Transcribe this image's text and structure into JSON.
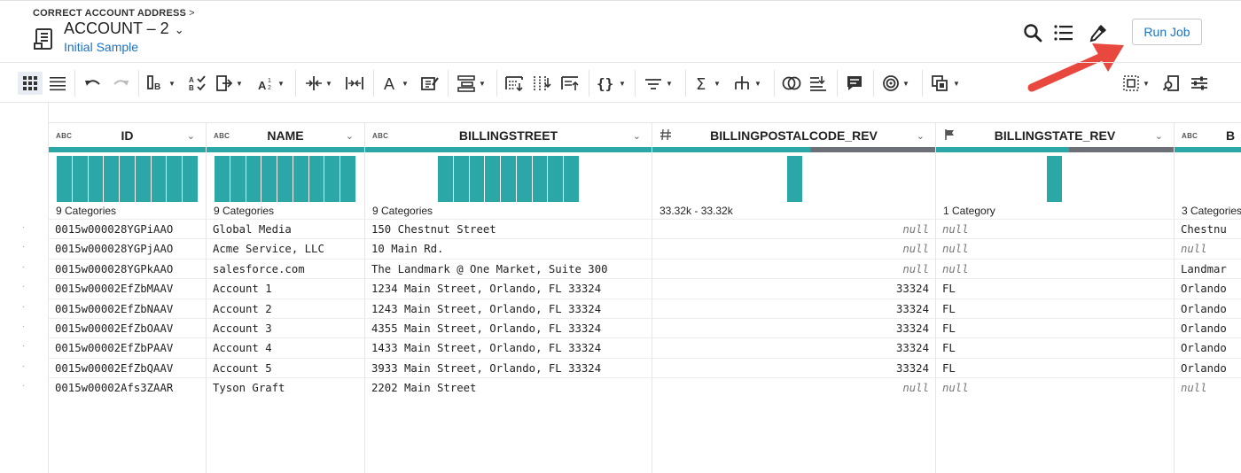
{
  "header": {
    "breadcrumb": "CORRECT ACCOUNT ADDRESS",
    "breadcrumb_chevron": ">",
    "title": "ACCOUNT – 2",
    "title_dropdown": "⌄",
    "subtitle": "Initial Sample",
    "run_job_label": "Run Job"
  },
  "colors": {
    "accent": "#1a73c8",
    "histogram": "#2aa7a6",
    "quality_valid": "#2aa7a6",
    "quality_missing": "#6e7078",
    "arrow": "#e8483d"
  },
  "toolbar_icons": [
    "grid-view-icon",
    "list-view-icon",
    "undo-icon",
    "redo-icon",
    "rename-columns-icon",
    "checklist-icon",
    "move-icon",
    "sort-icon",
    "split-icon",
    "merge-icon",
    "text-icon",
    "format-icon",
    "restructure-icon",
    "filter-rows-icon",
    "replace-icon",
    "extract-icon",
    "nested-icon",
    "filter-icon",
    "sum-icon",
    "hierarchy-icon",
    "join-icon",
    "union-icon",
    "comment-icon",
    "target-icon",
    "copy-icon",
    "selection-icon",
    "lookup-icon",
    "settings-icon"
  ],
  "columns": [
    {
      "type": "ABC",
      "name": "ID",
      "caret": "⌄",
      "category_label": "9 Categories"
    },
    {
      "type": "ABC",
      "name": "NAME",
      "caret": "⌄",
      "category_label": "9 Categories"
    },
    {
      "type": "ABC",
      "name": "BILLINGSTREET",
      "caret": "⌄",
      "category_label": "9 Categories"
    },
    {
      "type": "#",
      "name": "BILLINGPOSTALCODE_REV",
      "caret": "⌄",
      "category_label": "33.32k - 33.32k",
      "valid_fraction": 0.56
    },
    {
      "type": "flag",
      "name": "BILLINGSTATE_REV",
      "caret": "⌄",
      "category_label": "1 Category",
      "valid_fraction": 0.56
    },
    {
      "type": "ABC",
      "name": "B",
      "caret": "",
      "category_label": "3 Categories"
    }
  ],
  "rows": [
    [
      "0015w000028YGPiAAO",
      "Global Media",
      "150 Chestnut Street",
      "null",
      "null",
      "Chestnu"
    ],
    [
      "0015w000028YGPjAAO",
      "Acme Service, LLC",
      "10 Main Rd.",
      "null",
      "null",
      "null"
    ],
    [
      "0015w000028YGPkAAO",
      "salesforce.com",
      "The Landmark @ One Market, Suite 300",
      "null",
      "null",
      "Landmar"
    ],
    [
      "0015w00002EfZbMAAV",
      "Account 1",
      "1234 Main Street, Orlando, FL 33324",
      "33324",
      "FL",
      "Orlando"
    ],
    [
      "0015w00002EfZbNAAV",
      "Account 2",
      "1243 Main Street, Orlando, FL 33324",
      "33324",
      "FL",
      "Orlando"
    ],
    [
      "0015w00002EfZbOAAV",
      "Account 3",
      "4355 Main Street, Orlando, FL 33324",
      "33324",
      "FL",
      "Orlando"
    ],
    [
      "0015w00002EfZbPAAV",
      "Account 4",
      "1433 Main Street, Orlando, FL 33324",
      "33324",
      "FL",
      "Orlando"
    ],
    [
      "0015w00002EfZbQAAV",
      "Account 5",
      "3933 Main Street, Orlando, FL 33324",
      "33324",
      "FL",
      "Orlando"
    ],
    [
      "0015w00002Afs3ZAAR",
      "Tyson Graft",
      "2202 Main Street",
      "null",
      "null",
      "null"
    ]
  ],
  "histograms": [
    {
      "bars": 9
    },
    {
      "bars": 9
    },
    {
      "bars": 9
    },
    {
      "bars": 1
    },
    {
      "bars": 1
    },
    {
      "bars": 0
    }
  ]
}
